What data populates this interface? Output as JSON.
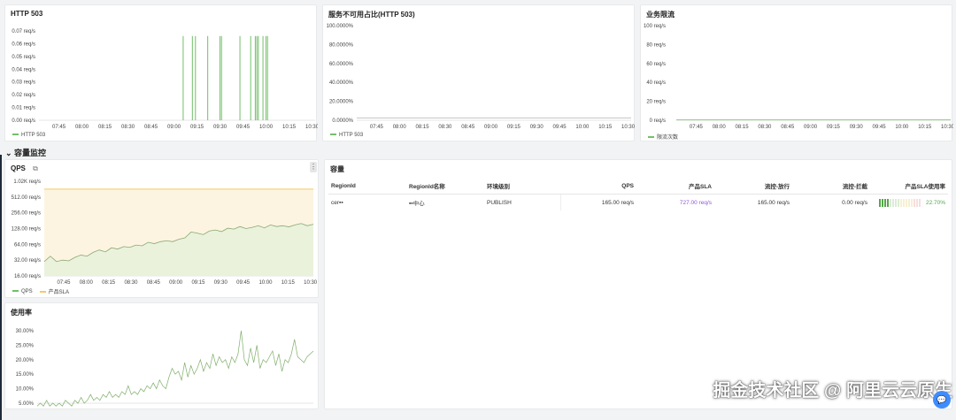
{
  "time_labels": [
    "07:45",
    "08:00",
    "08:15",
    "08:30",
    "08:45",
    "09:00",
    "09:15",
    "09:30",
    "09:45",
    "10:00",
    "10:15",
    "10:30"
  ],
  "panels": {
    "http503": {
      "title": "HTTP 503",
      "y_labels": [
        "0.07 req/s",
        "0.06 req/s",
        "0.05 req/s",
        "0.04 req/s",
        "0.03 req/s",
        "0.02 req/s",
        "0.01 req/s",
        "0.00 req/s"
      ],
      "legend": "HTTP 503",
      "color": "#73bf69"
    },
    "unavail": {
      "title": "服务不可用占比(HTTP 503)",
      "y_labels": [
        "100.0000%",
        "80.0000%",
        "60.0000%",
        "40.0000%",
        "20.0000%",
        "0.0000%"
      ],
      "legend": "HTTP 503",
      "color": "#73bf69"
    },
    "limit": {
      "title": "业务限流",
      "y_labels": [
        "100 req/s",
        "80 req/s",
        "60 req/s",
        "40 req/s",
        "20 req/s",
        "0 req/s"
      ],
      "legend": "限流次数",
      "color": "#73bf69"
    },
    "qps": {
      "title": "QPS",
      "y_labels": [
        "1.02K req/s",
        "512.00 req/s",
        "256.00 req/s",
        "128.00 req/s",
        "64.00 req/s",
        "32.00 req/s",
        "16.00 req/s"
      ],
      "legend": [
        "QPS",
        "产品SLA"
      ],
      "colors": [
        "#73bf69",
        "#f2c96d"
      ]
    },
    "usage": {
      "title": "使用率",
      "y_labels": [
        "30.00%",
        "25.00%",
        "20.00%",
        "15.00%",
        "10.00%",
        "5.00%"
      ]
    },
    "capacity": {
      "title": "容量",
      "columns": [
        "RegionId",
        "Regionld名称",
        "环境级别",
        "QPS",
        "产品SLA",
        "流控-放行",
        "流控-拦截",
        "产品SLA使用率"
      ],
      "rows": [
        [
          "cer▪▪",
          "▪▪中心",
          "PUBLISH",
          "165.00 req/s",
          "727.00 req/s",
          "165.00 req/s",
          "0.00 req/s",
          "22.70%"
        ]
      ],
      "sla_usage_fraction": 0.227
    }
  },
  "row_header": "容量监控",
  "watermark": "掘金技术社区 @ 阿里云云原生",
  "chart_data": [
    {
      "type": "bar",
      "title": "HTTP 503",
      "x": [
        "09:06",
        "09:12",
        "09:14",
        "09:22",
        "09:30",
        "09:31",
        "09:43",
        "09:50",
        "09:53",
        "09:54",
        "09:55",
        "09:58",
        "10:00",
        "10:01"
      ],
      "values": [
        0.066,
        0.066,
        0.066,
        0.066,
        0.066,
        0.066,
        0.066,
        0.066,
        0.066,
        0.066,
        0.066,
        0.066,
        0.066,
        0.066
      ],
      "ylim": [
        0,
        0.07
      ]
    },
    {
      "type": "line",
      "title": "服务不可用占比(HTTP 503)",
      "values_constant": 2.5,
      "ylim": [
        0,
        100
      ]
    },
    {
      "type": "line",
      "title": "业务限流",
      "values_constant": 0,
      "ylim": [
        0,
        100
      ]
    },
    {
      "type": "area",
      "title": "QPS",
      "x_start": "07:35",
      "x_step_min": 5,
      "series": [
        {
          "name": "QPS",
          "values": [
            30,
            38,
            30,
            32,
            31,
            36,
            40,
            38,
            45,
            50,
            46,
            55,
            52,
            58,
            56,
            62,
            60,
            70,
            66,
            72,
            75,
            72,
            80,
            85,
            110,
            105,
            98,
            115,
            120,
            112,
            130,
            125,
            140,
            128,
            135,
            145,
            132,
            150,
            140,
            145,
            138,
            150,
            160,
            145,
            155
          ]
        },
        {
          "name": "产品SLA",
          "values_constant": 727
        }
      ],
      "yscale": "log2",
      "ylim": [
        16,
        1024
      ]
    },
    {
      "type": "line",
      "title": "使用率",
      "x_start": "07:33",
      "x_step_min": 2,
      "values": [
        4,
        5,
        4,
        6,
        4,
        5,
        4,
        5,
        4,
        6,
        5,
        4,
        6,
        5,
        7,
        5,
        6,
        8,
        6,
        7,
        6,
        8,
        7,
        9,
        7,
        8,
        7,
        9,
        8,
        11,
        8,
        9,
        8,
        10,
        9,
        11,
        10,
        12,
        10,
        13,
        11,
        10,
        14,
        17,
        15,
        16,
        13,
        19,
        14,
        18,
        15,
        17,
        20,
        16,
        19,
        17,
        22,
        18,
        21,
        19,
        20,
        17,
        21,
        19,
        22,
        30,
        20,
        18,
        24,
        19,
        25,
        17,
        20,
        19,
        21,
        23,
        18,
        22,
        16,
        20,
        19,
        22,
        27,
        21,
        20,
        19,
        21,
        22,
        23
      ],
      "ylim": [
        5,
        30
      ]
    }
  ]
}
